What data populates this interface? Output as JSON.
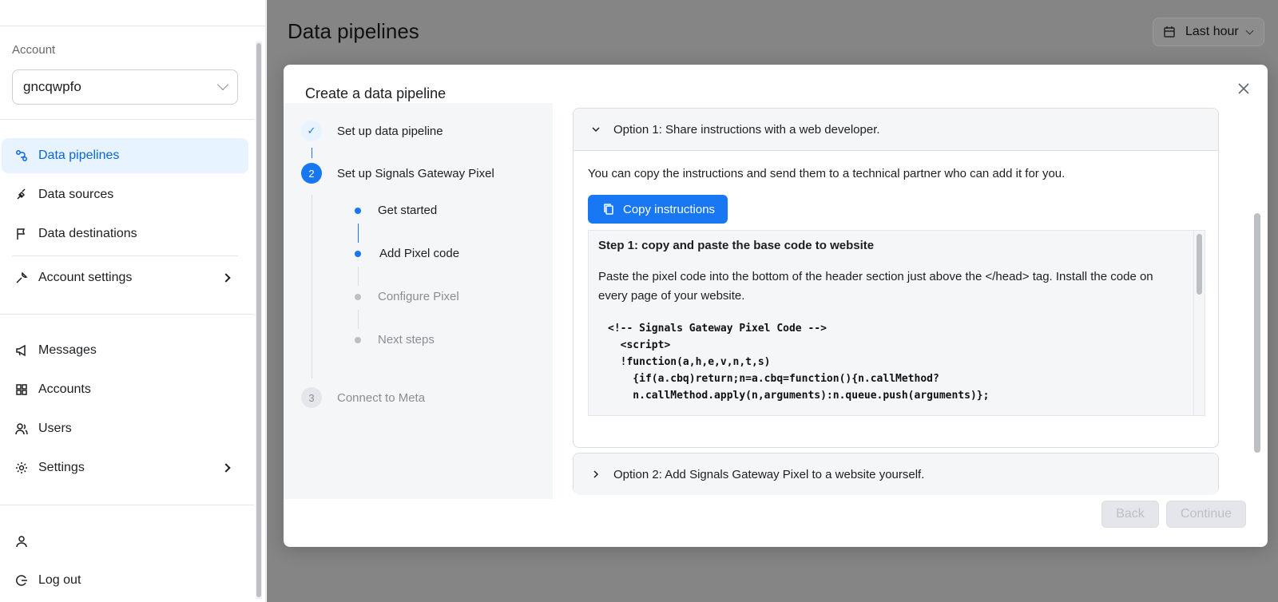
{
  "sidebar": {
    "account_label": "Account",
    "account_value": "gncqwpfo",
    "items": [
      {
        "label": "Data pipelines"
      },
      {
        "label": "Data sources"
      },
      {
        "label": "Data destinations"
      },
      {
        "label": "Account settings"
      },
      {
        "label": "Messages"
      },
      {
        "label": "Accounts"
      },
      {
        "label": "Users"
      },
      {
        "label": "Settings"
      },
      {
        "label": "Log out"
      }
    ]
  },
  "header": {
    "title": "Data pipelines",
    "range_label": "Last hour"
  },
  "modal": {
    "title": "Create a data pipeline",
    "steps": [
      {
        "label": "Set up data pipeline",
        "number": "✓"
      },
      {
        "label": "Set up Signals Gateway Pixel",
        "number": "2"
      },
      {
        "label": "Connect to Meta",
        "number": "3"
      }
    ],
    "substeps": [
      {
        "label": "Get started"
      },
      {
        "label": "Add Pixel code"
      },
      {
        "label": "Configure Pixel"
      },
      {
        "label": "Next steps"
      }
    ],
    "option1": {
      "title": "Option 1: Share instructions with a web developer.",
      "description": "You can copy the instructions and send them to a technical partner who can add it for you.",
      "copy_button": "Copy instructions",
      "step_heading": "Step 1: copy and paste the base code to website",
      "step_text": "Paste the pixel code into the bottom of the header section just above the </head> tag. Install the code on every page of your website.",
      "code": "<!-- Signals Gateway Pixel Code -->\n  <script>\n  !function(a,h,e,v,n,t,s)\n    {if(a.cbq)return;n=a.cbq=function(){n.callMethod?\n    n.callMethod.apply(n,arguments):n.queue.push(arguments)};"
    },
    "option2": {
      "title": "Option 2: Add Signals Gateway Pixel to a website yourself."
    },
    "back_label": "Back",
    "continue_label": "Continue"
  },
  "colors": {
    "accent": "#1877f2",
    "overlay": "#858585",
    "active_bg": "#e7f3ff"
  }
}
